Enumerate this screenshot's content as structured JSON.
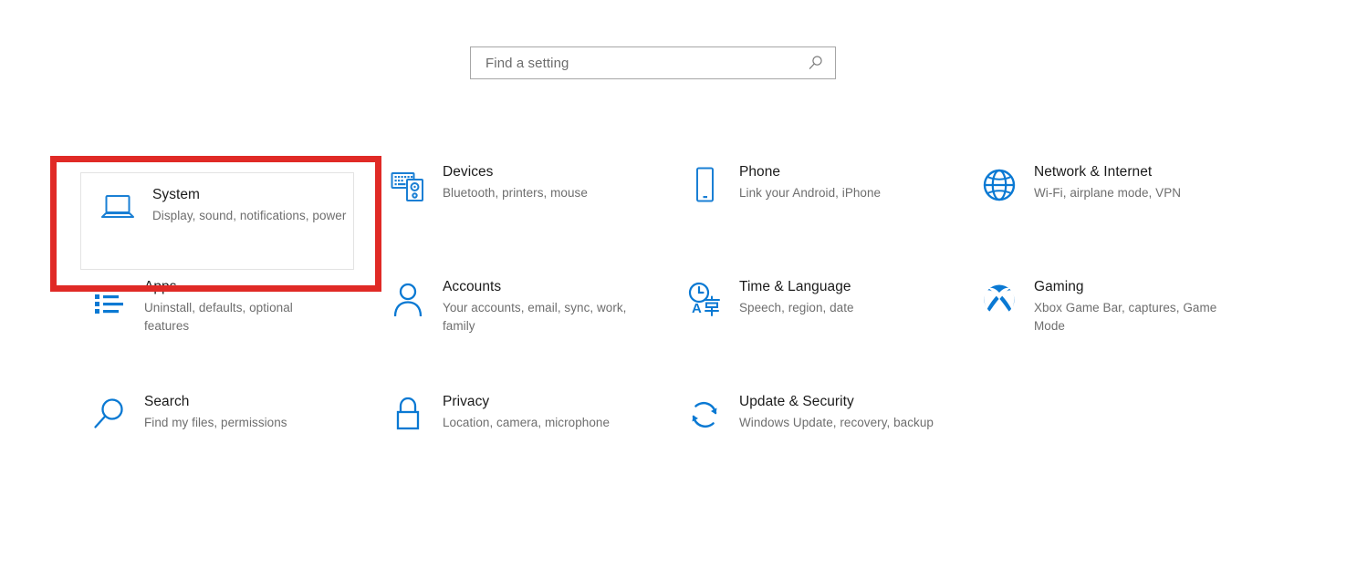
{
  "search": {
    "placeholder": "Find a setting",
    "value": "",
    "icon": "search-icon"
  },
  "highlight": {
    "color": "#e02a26",
    "target": "System"
  },
  "colors": {
    "accent_blue": "#0a79d3",
    "icon_blue": "#1a7fd4",
    "title_text": "#1b1b1b",
    "desc_text": "#6e6e6e",
    "tile_border": "#e3e3e3",
    "search_border": "#a6a6a6",
    "highlight_red": "#e02a26",
    "background": "#ffffff"
  },
  "grid": {
    "rows": [
      [
        {
          "icon": "laptop-icon",
          "title": "System",
          "desc": "Display, sound, notifications, power",
          "highlighted": true
        },
        {
          "icon": "keyboard-device-icon",
          "title": "Devices",
          "desc": "Bluetooth, printers, mouse",
          "highlighted": false
        },
        {
          "icon": "phone-icon",
          "title": "Phone",
          "desc": "Link your Android, iPhone",
          "highlighted": false
        },
        {
          "icon": "globe-icon",
          "title": "Network & Internet",
          "desc": "Wi-Fi, airplane mode, VPN",
          "highlighted": false
        }
      ],
      [
        {
          "icon": "list-icon",
          "title": "Apps",
          "desc": "Uninstall, defaults, optional features",
          "highlighted": false
        },
        {
          "icon": "person-icon",
          "title": "Accounts",
          "desc": "Your accounts, email, sync, work, family",
          "highlighted": false
        },
        {
          "icon": "clock-language-icon",
          "title": "Time & Language",
          "desc": "Speech, region, date",
          "highlighted": false
        },
        {
          "icon": "xbox-icon",
          "title": "Gaming",
          "desc": "Xbox Game Bar, captures, Game Mode",
          "highlighted": false
        }
      ],
      [
        {
          "icon": "magnifier-icon",
          "title": "Search",
          "desc": "Find my files, permissions",
          "highlighted": false
        },
        {
          "icon": "lock-icon",
          "title": "Privacy",
          "desc": "Location, camera, microphone",
          "highlighted": false
        },
        {
          "icon": "refresh-icon",
          "title": "Update & Security",
          "desc": "Windows Update, recovery, backup",
          "highlighted": false
        }
      ]
    ]
  }
}
